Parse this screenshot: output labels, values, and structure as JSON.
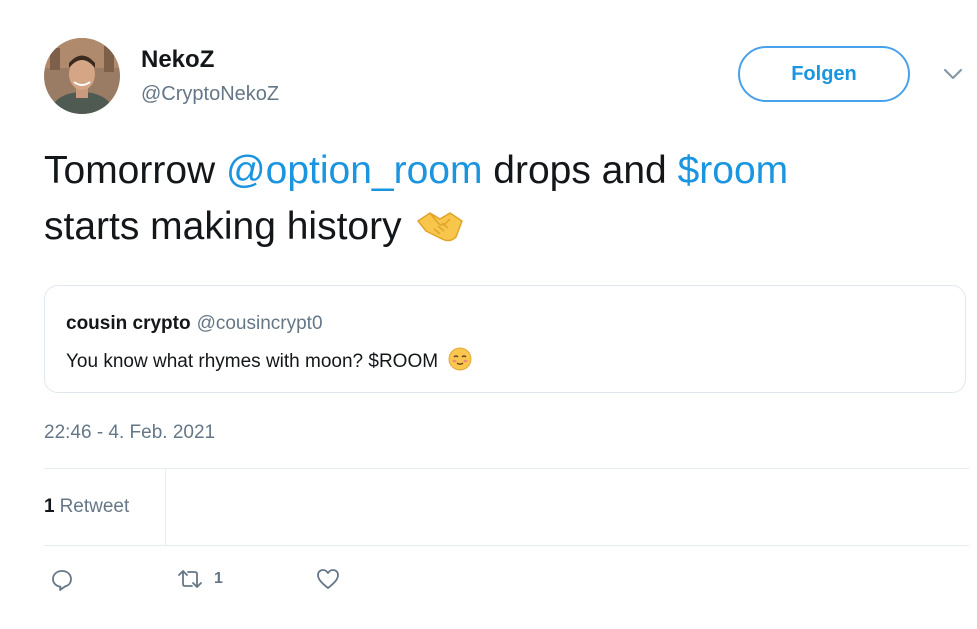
{
  "author": {
    "name": "NekoZ",
    "handle": "@CryptoNekoZ"
  },
  "follow_button": {
    "label": "Folgen"
  },
  "tweet": {
    "text_1": "Tomorrow ",
    "mention": "@option_room",
    "text_2": " drops and ",
    "cashtag": "$room",
    "text_3": " starts making history",
    "emoji": "handshake-emoji"
  },
  "quoted_tweet": {
    "name": "cousin crypto",
    "handle": "@cousincrypt0",
    "text": "You know what rhymes with moon? $ROOM",
    "emoji": "relieved-face-emoji"
  },
  "timestamp": "22:46 - 4. Feb. 2021",
  "stats": {
    "retweet_count": "1",
    "retweet_label": "Retweet"
  },
  "actions": {
    "reply_icon": "reply-icon",
    "retweet_icon": "retweet-icon",
    "retweet_count": "1",
    "like_icon": "heart-icon"
  },
  "colors": {
    "link": "#1b95e0",
    "secondary_text": "#657786",
    "border": "#e1e8ed"
  }
}
